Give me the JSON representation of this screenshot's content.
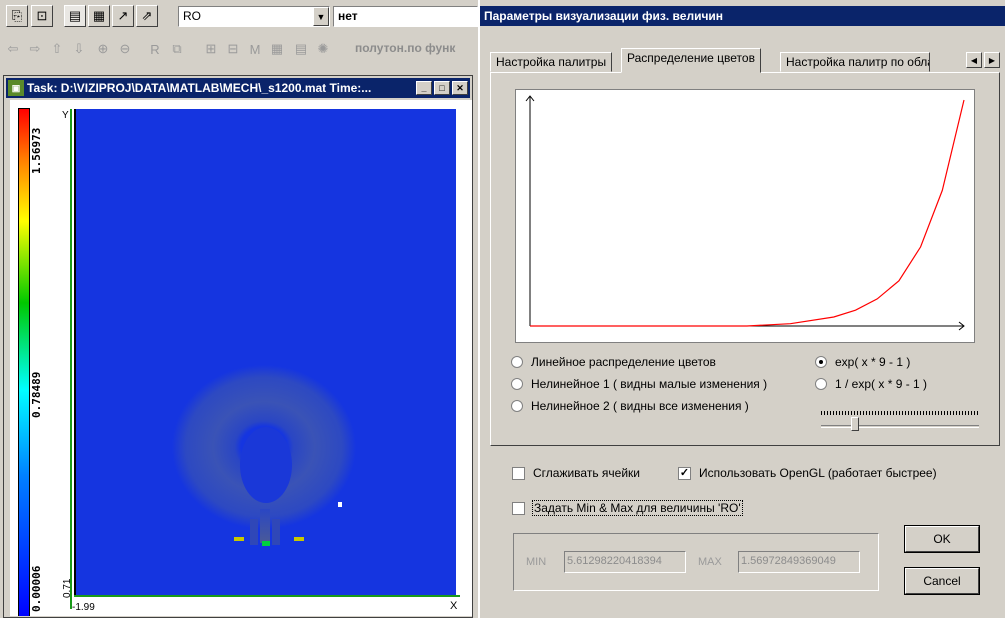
{
  "toolbar": {
    "variable_combo_value": "RO",
    "palette_combo_value": "нет",
    "function_label": "полутон.по функ"
  },
  "task_window": {
    "title": "Task: D:\\VIZIPROJ\\DATA\\MATLAB\\MECH\\_s1200.mat Time:...",
    "colorbar_max": "1.56973",
    "colorbar_mid": "0.78489",
    "colorbar_min": "0.00006",
    "y_axis_letter": "Y",
    "x_axis_letter": "X",
    "x_min": "-1.99",
    "y_min": "0.71"
  },
  "dialog": {
    "title": "Параметры визуализации физ. величин",
    "tabs": [
      {
        "label": "Настройка палитры",
        "active": false
      },
      {
        "label": "Распределение цветов",
        "active": true
      },
      {
        "label": "Настройка палитр по обла",
        "active": false
      }
    ],
    "radios": {
      "linear": {
        "label": "Линейное распределение цветов",
        "checked": false
      },
      "nonlinear1": {
        "label": "Нелинейное 1 ( видны малые изменения )",
        "checked": false
      },
      "nonlinear2": {
        "label": "Нелинейное 2 ( видны все изменения )",
        "checked": false
      },
      "exp": {
        "label": "exp( x * 9 - 1 )",
        "checked": true
      },
      "inv_exp": {
        "label": "1 / exp( x * 9 - 1 )",
        "checked": false
      }
    },
    "slider_value": 0.2,
    "smooth_cells": {
      "label": "Сглаживать ячейки",
      "checked": false
    },
    "use_opengl": {
      "label": "Использовать OpenGL (работает быстрее)",
      "checked": true
    },
    "set_minmax": {
      "label": "Задать Min & Max для величины 'RO'",
      "checked": false
    },
    "min_label": "MIN",
    "min_value": "5.61298220418394",
    "max_label": "MAX",
    "max_value": "1.56972849369049",
    "ok_label": "OK",
    "cancel_label": "Cancel"
  },
  "chart_data": {
    "type": "line",
    "title": "",
    "xlabel": "",
    "ylabel": "",
    "xlim": [
      0,
      1
    ],
    "ylim": [
      0,
      1
    ],
    "grid": false,
    "series": [
      {
        "color": "#ff0000",
        "x": [
          0,
          0.1,
          0.2,
          0.3,
          0.4,
          0.5,
          0.6,
          0.7,
          0.75,
          0.8,
          0.85,
          0.9,
          0.95,
          1.0
        ],
        "y": [
          0,
          0,
          0,
          0,
          0,
          0,
          0.01,
          0.04,
          0.07,
          0.12,
          0.2,
          0.35,
          0.6,
          1.0
        ]
      }
    ]
  }
}
